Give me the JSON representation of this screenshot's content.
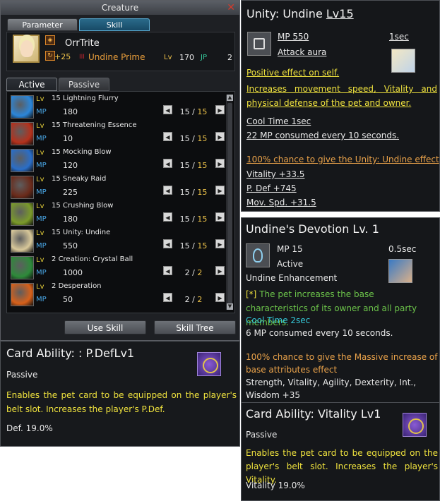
{
  "window": {
    "title": "Creature",
    "close_glyph": "✕",
    "tabs": [
      "Parameter",
      "Skill"
    ],
    "creature": {
      "name": "OrrTrite",
      "plus": "+25",
      "roman_glyph": "III",
      "type": "Undine Prime",
      "lv_label": "Lv",
      "lv_value": "170",
      "jp_label": "JP",
      "jp_value": "2"
    },
    "subtabs": [
      "Active",
      "Passive"
    ],
    "lv_label": "Lv",
    "mp_label": "MP",
    "skills": [
      {
        "lv": "15",
        "name": "Lightning Flurry",
        "mp": "180",
        "cur": "15",
        "max": "15",
        "color": "#2b86d9"
      },
      {
        "lv": "15",
        "name": "Threatening Essence",
        "mp": "10",
        "cur": "15",
        "max": "15",
        "color": "#b4311c"
      },
      {
        "lv": "15",
        "name": "Mocking Blow",
        "mp": "120",
        "cur": "15",
        "max": "15",
        "color": "#2a6ec8"
      },
      {
        "lv": "15",
        "name": "Sneaky Raid",
        "mp": "225",
        "cur": "15",
        "max": "15",
        "color": "#6a2a1a"
      },
      {
        "lv": "15",
        "name": "Crushing Blow",
        "mp": "180",
        "cur": "15",
        "max": "15",
        "color": "#7a9a2a"
      },
      {
        "lv": "15",
        "name": "Unity: Undine",
        "mp": "550",
        "cur": "15",
        "max": "15",
        "color": "#d8c89a"
      },
      {
        "lv": "2",
        "name": "Creation: Crystal Ball",
        "mp": "1000",
        "cur": "2",
        "max": "2",
        "color": "#2e8a3a"
      },
      {
        "lv": "2",
        "name": "Desperation",
        "mp": "50",
        "cur": "2",
        "max": "2",
        "color": "#d7601a"
      }
    ],
    "count_sep": "/",
    "arrow_left": "◀",
    "arrow_right": "▶",
    "scroll_up": "▲",
    "scroll_down": "▼",
    "buttons": {
      "use_skill": "Use Skill",
      "skill_tree": "Skill Tree"
    }
  },
  "unity_tip": {
    "title_prefix": "Unity: Undine",
    "title_lv": "Lv15",
    "mp": "MP 550",
    "time": "1sec",
    "aura": "Attack aura",
    "positive": "Positive effect on self.",
    "line1": "Increases movement speed, Vitality and physical defense of the pet and owner.",
    "cool": "Cool Time 1sec",
    "consume": "22 MP consumed every 10 seconds.",
    "chance": "100% chance to give the Unity: Undine effect",
    "stats": [
      "Vitality +33.5",
      "P. Def +745",
      "Mov. Spd. +31.5"
    ]
  },
  "devotion_tip": {
    "title": "Undine's Devotion Lv. 1",
    "mp": "MP 15",
    "time": "0.5sec",
    "active": "Active",
    "type": "Undine Enhancement",
    "star": "[*]",
    "desc": "The pet increases the base characteristics of its owner and all party members.",
    "cool": "Cool Time 2sec",
    "consume": "6 MP consumed every 10 seconds.",
    "chance": "100% chance to give the Massive increase of base attributes effect",
    "stats": "Strength, Vitality, Agility, Dexterity, Int., Wisdom +35"
  },
  "card_left": {
    "title": "Card Ability: : P.DefLv1",
    "passive": "Passive",
    "desc": "Enables the pet card to be equipped on the player's belt slot. Increases the player's P.Def.",
    "stat": "Def. 19.0%"
  },
  "card_right": {
    "title": "Card Ability: Vitality Lv1",
    "passive": "Passive",
    "desc": "Enables the pet card to be equipped on the player's belt slot. Increases the player's Vitality.",
    "stat": "Vitality 19.0%"
  }
}
